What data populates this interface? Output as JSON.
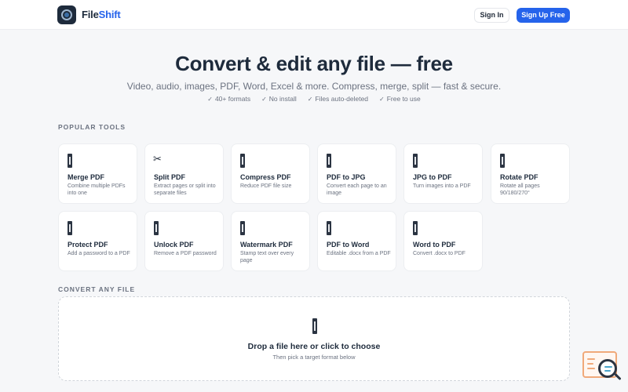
{
  "header": {
    "brand_prefix": "File",
    "brand_suffix": "Shift",
    "signin_label": "Sign In",
    "signup_label": "Sign Up Free"
  },
  "hero": {
    "title": "Convert & edit any file — free",
    "subtitle": "Video, audio, images, PDF, Word, Excel & more. Compress, merge, split — fast & secure.",
    "features": [
      "40+ formats",
      "No install",
      "Files auto-deleted",
      "Free to use"
    ],
    "check_glyph": "✓"
  },
  "popular": {
    "label": "POPULAR TOOLS",
    "tools": [
      {
        "title": "Merge PDF",
        "desc": "Combine multiple PDFs into one",
        "icon": "file-icon"
      },
      {
        "title": "Split PDF",
        "desc": "Extract pages or split into separate files",
        "icon": "scissors-icon"
      },
      {
        "title": "Compress PDF",
        "desc": "Reduce PDF file size",
        "icon": "file-icon"
      },
      {
        "title": "PDF to JPG",
        "desc": "Convert each page to an image",
        "icon": "file-icon"
      },
      {
        "title": "JPG to PDF",
        "desc": "Turn images into a PDF",
        "icon": "file-icon"
      },
      {
        "title": "Rotate PDF",
        "desc": "Rotate all pages 90/180/270°",
        "icon": "file-icon"
      },
      {
        "title": "Protect PDF",
        "desc": "Add a password to a PDF",
        "icon": "file-icon"
      },
      {
        "title": "Unlock PDF",
        "desc": "Remove a PDF password",
        "icon": "file-icon"
      },
      {
        "title": "Watermark PDF",
        "desc": "Stamp text over every page",
        "icon": "file-icon"
      },
      {
        "title": "PDF to Word",
        "desc": "Editable .docx from a PDF",
        "icon": "file-icon"
      },
      {
        "title": "Word to PDF",
        "desc": "Convert .docx to PDF",
        "icon": "file-icon"
      }
    ]
  },
  "convert": {
    "label": "CONVERT ANY FILE",
    "drop_title": "Drop a file here or click to choose",
    "drop_sub": "Then pick a target format below"
  },
  "colors": {
    "accent": "#2563eb",
    "brand_dark": "#1e2b3c",
    "widget_orange": "#f0a97a"
  }
}
